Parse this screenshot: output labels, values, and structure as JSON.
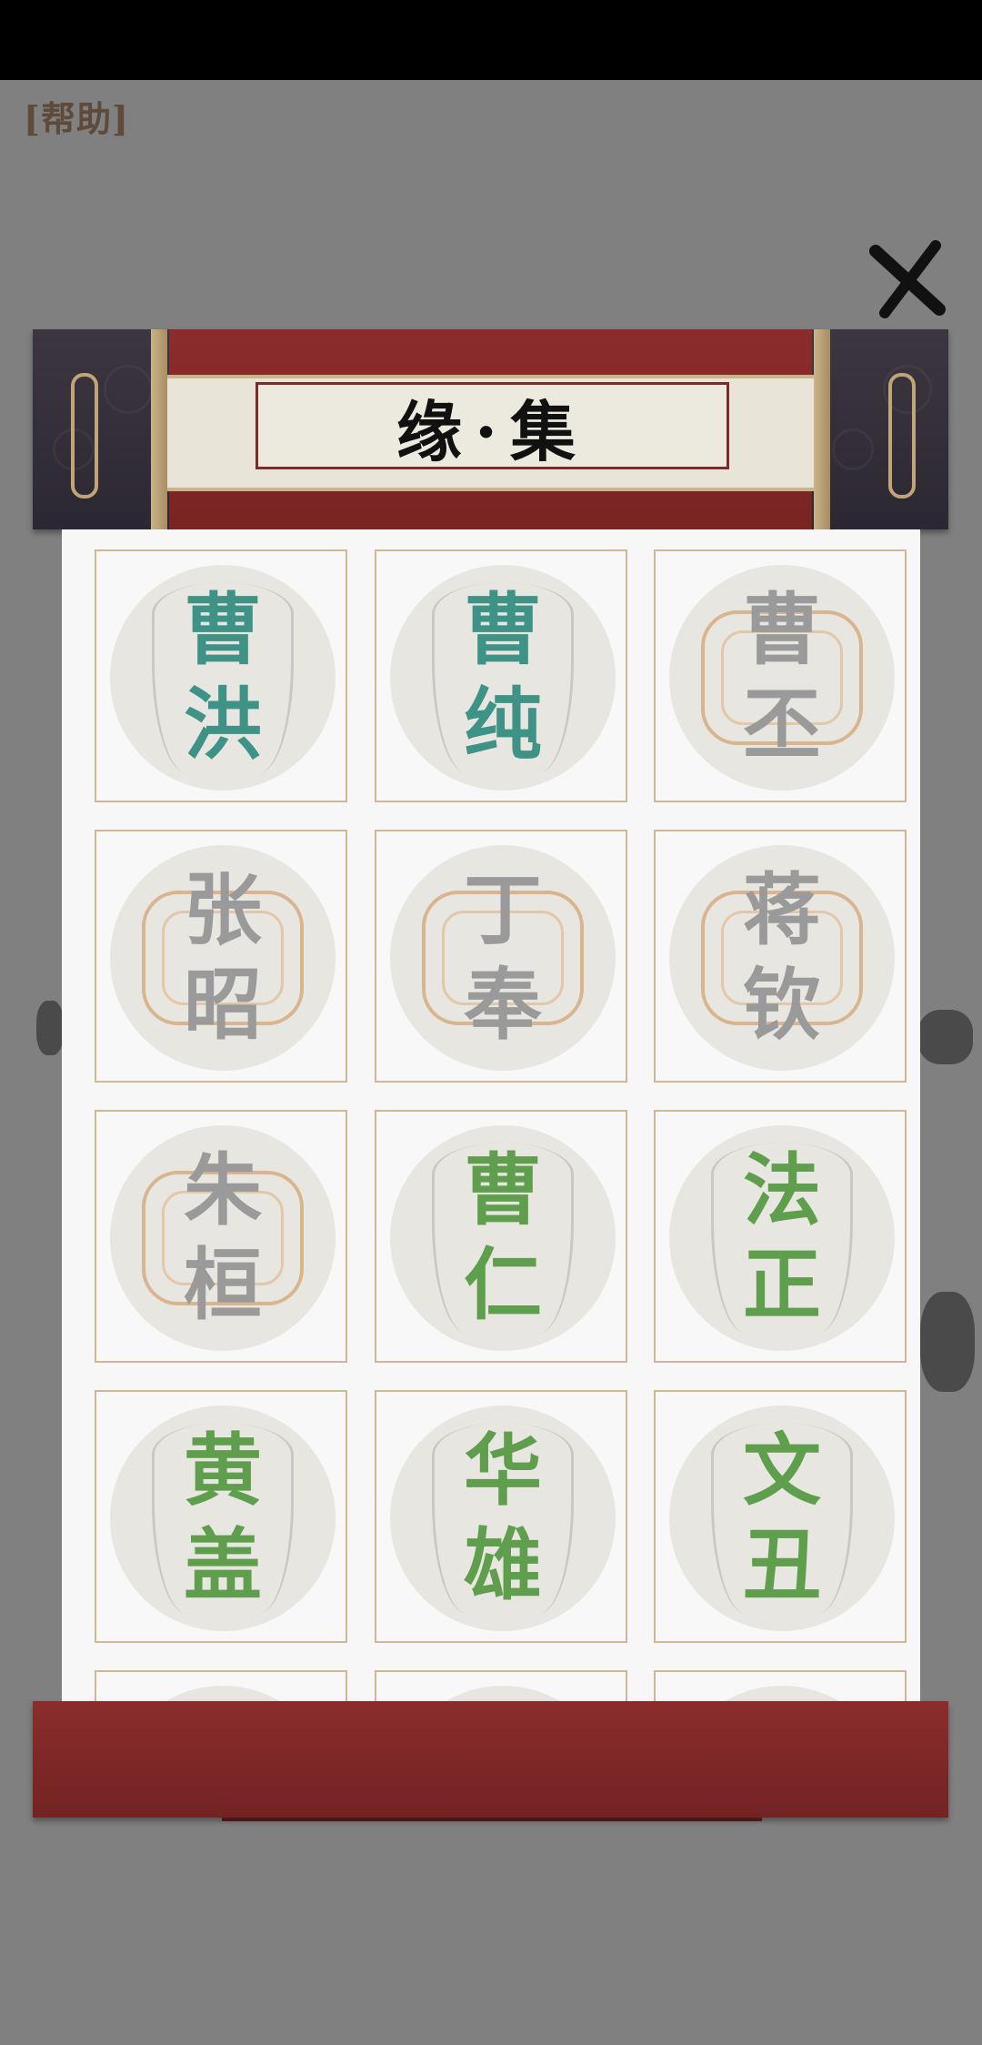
{
  "help_label": "[帮助]",
  "close_icon": "close-x-icon",
  "title": "缘·集",
  "cards": [
    {
      "name": "曹洪",
      "line1": "曹",
      "line2": "洪",
      "state": "collected-teal"
    },
    {
      "name": "曹纯",
      "line1": "曹",
      "line2": "纯",
      "state": "collected-teal"
    },
    {
      "name": "曹丕",
      "line1": "曹",
      "line2": "丕",
      "state": "locked"
    },
    {
      "name": "张昭",
      "line1": "张",
      "line2": "昭",
      "state": "locked"
    },
    {
      "name": "丁奉",
      "line1": "丁",
      "line2": "奉",
      "state": "locked"
    },
    {
      "name": "蒋钦",
      "line1": "蒋",
      "line2": "钦",
      "state": "locked"
    },
    {
      "name": "朱桓",
      "line1": "朱",
      "line2": "桓",
      "state": "locked"
    },
    {
      "name": "曹仁",
      "line1": "曹",
      "line2": "仁",
      "state": "collected-green"
    },
    {
      "name": "法正",
      "line1": "法",
      "line2": "正",
      "state": "collected-green"
    },
    {
      "name": "黄盖",
      "line1": "黄",
      "line2": "盖",
      "state": "collected-green"
    },
    {
      "name": "华雄",
      "line1": "华",
      "line2": "雄",
      "state": "collected-green"
    },
    {
      "name": "文丑",
      "line1": "文",
      "line2": "丑",
      "state": "collected-green"
    }
  ],
  "colors": {
    "teal": "#3e9386",
    "gray": "#9a9a9a",
    "green": "#5f9e4c",
    "scroll_red": "#8b2c2c"
  }
}
